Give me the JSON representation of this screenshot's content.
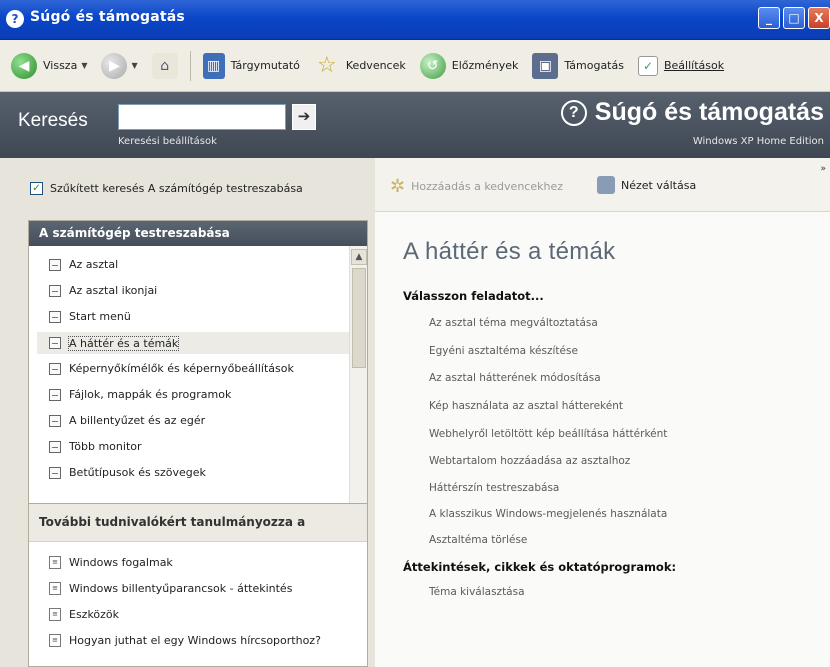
{
  "window": {
    "title": "Súgó és támogatás",
    "buttons": [
      "_",
      "□",
      "X"
    ]
  },
  "toolbar": {
    "back": "Vissza",
    "index": "Tárgymutató",
    "favorites": "Kedvencek",
    "history": "Előzmények",
    "support": "Támogatás",
    "options": "Beállítások"
  },
  "search": {
    "label": "Keresés",
    "value": "",
    "go": "➔",
    "options_link": "Keresési beállítások"
  },
  "brand": {
    "title": "Súgó és támogatás",
    "edition": "Windows XP Home Edition",
    "icon": "?"
  },
  "left": {
    "narrow_search": "Szűkített keresés A számítógép testreszabása",
    "panel_title": "A számítógép testreszabása",
    "items": [
      "Az asztal",
      "Az asztal ikonjai",
      "Start menü",
      "A háttér és a témák",
      "Képernyőkímélők és képernyőbeállítások",
      "Fájlok, mappák és programok",
      "A billentyűzet és az egér",
      "Több monitor",
      "Betűtípusok és szövegek"
    ],
    "more_title": "További tudnivalókért tanulmányozza a",
    "more_items": [
      "Windows fogalmak",
      "Windows billentyűparancsok - áttekintés",
      "Eszközök",
      "Hogyan juthat el egy Windows hírcsoporthoz?"
    ]
  },
  "right": {
    "add_favorite": "Hozzáadás a kedvencekhez",
    "change_view": "Nézet váltása",
    "title": "A háttér és a témák",
    "section1": "Válasszon feladatot...",
    "tasks": [
      "Az asztal téma megváltoztatása",
      "Egyéni asztaltéma készítése",
      "Az asztal hátterének módosítása",
      "Kép használata az asztal háttereként",
      "Webhelyről letöltött kép beállítása háttérként",
      "Webtartalom hozzáadása az asztalhoz",
      "Háttérszín testreszabása",
      "A klasszikus Windows-megjelenés használata",
      "Asztaltéma törlése"
    ],
    "section2": "Áttekintések, cikkek és oktatóprogramok:",
    "articles": [
      "Téma kiválasztása"
    ]
  }
}
